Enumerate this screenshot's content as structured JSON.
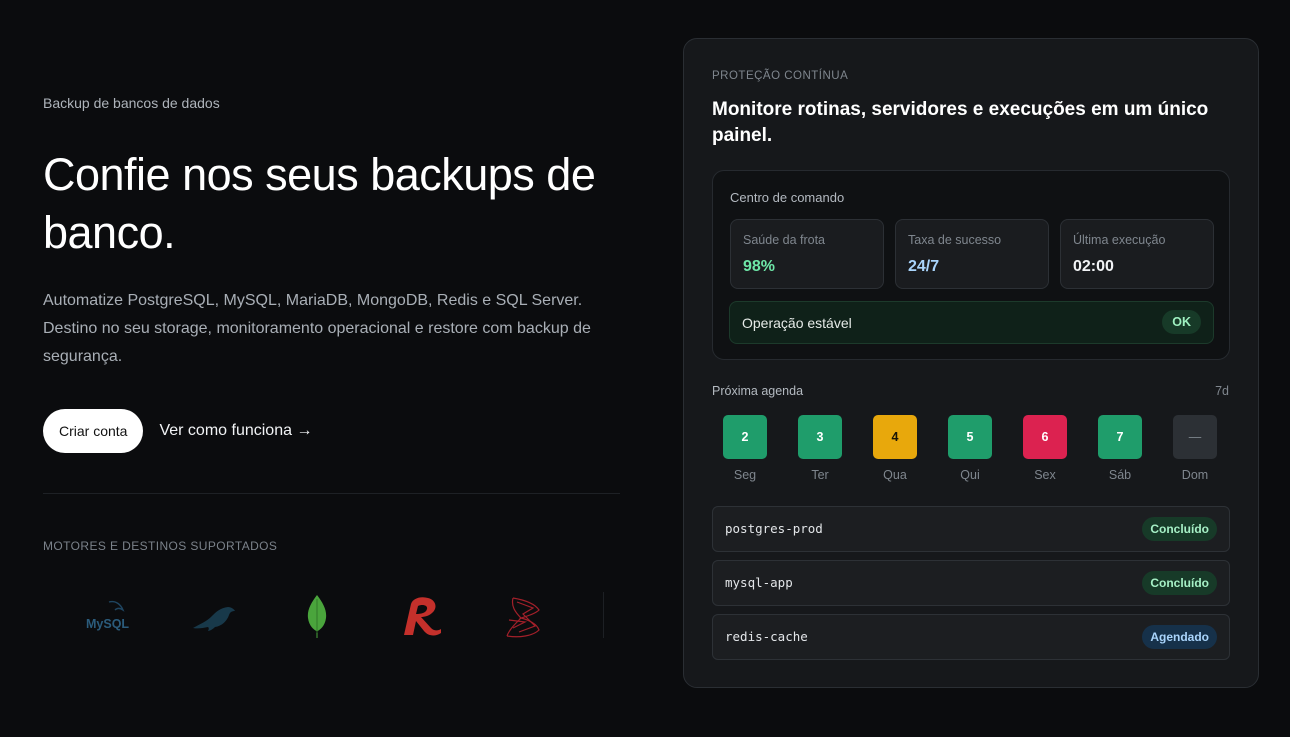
{
  "hero": {
    "eyebrow": "Backup de bancos de dados",
    "title": "Confie nos seus backups de banco.",
    "description": "Automatize PostgreSQL, MySQL, MariaDB, MongoDB, Redis e SQL Server. Destino no seu storage, monitoramento operacional e restore com backup de segurança.",
    "primary_cta": "Criar conta",
    "secondary_cta": "Ver como funciona →",
    "engines_label": "MOTORES E DESTINOS SUPORTADOS",
    "logos": [
      {
        "name": "mysql-logo",
        "text": "MySQL"
      },
      {
        "name": "mariadb-logo",
        "text": ""
      },
      {
        "name": "mongodb-logo",
        "text": ""
      },
      {
        "name": "redis-logo",
        "text": ""
      },
      {
        "name": "sql-server-logo",
        "text": ""
      }
    ]
  },
  "card": {
    "eyebrow": "PROTEÇÃO CONTÍNUA",
    "title": "Monitore rotinas, servidores e execuções em um único painel.",
    "command_center": {
      "label": "Centro de comando",
      "metrics": [
        {
          "label": "Saúde da frota",
          "value": "98%",
          "color": "#6ee7a8"
        },
        {
          "label": "Taxa de sucesso",
          "value": "24/7",
          "color": "#a9d4fb"
        },
        {
          "label": "Última execução",
          "value": "02:00",
          "color": "#f1f3f5"
        }
      ],
      "status": {
        "text": "Operação estável",
        "badge": "OK"
      }
    },
    "agenda": {
      "label": "Próxima agenda",
      "range": "7d",
      "days": [
        {
          "num": "2",
          "name": "Seg",
          "color": "#1f9d6b"
        },
        {
          "num": "3",
          "name": "Ter",
          "color": "#1f9d6b"
        },
        {
          "num": "4",
          "name": "Qua",
          "color": "#e8a80c"
        },
        {
          "num": "5",
          "name": "Qui",
          "color": "#1f9d6b"
        },
        {
          "num": "6",
          "name": "Sex",
          "color": "#dc2250"
        },
        {
          "num": "7",
          "name": "Sáb",
          "color": "#1f9d6b"
        },
        {
          "num": "—",
          "name": "Dom",
          "color": "#2c3035"
        }
      ]
    },
    "jobs": [
      {
        "name": "postgres-prod",
        "status": "Concluído",
        "kind": "done"
      },
      {
        "name": "mysql-app",
        "status": "Concluído",
        "kind": "done"
      },
      {
        "name": "redis-cache",
        "status": "Agendado",
        "kind": "sched"
      }
    ]
  }
}
